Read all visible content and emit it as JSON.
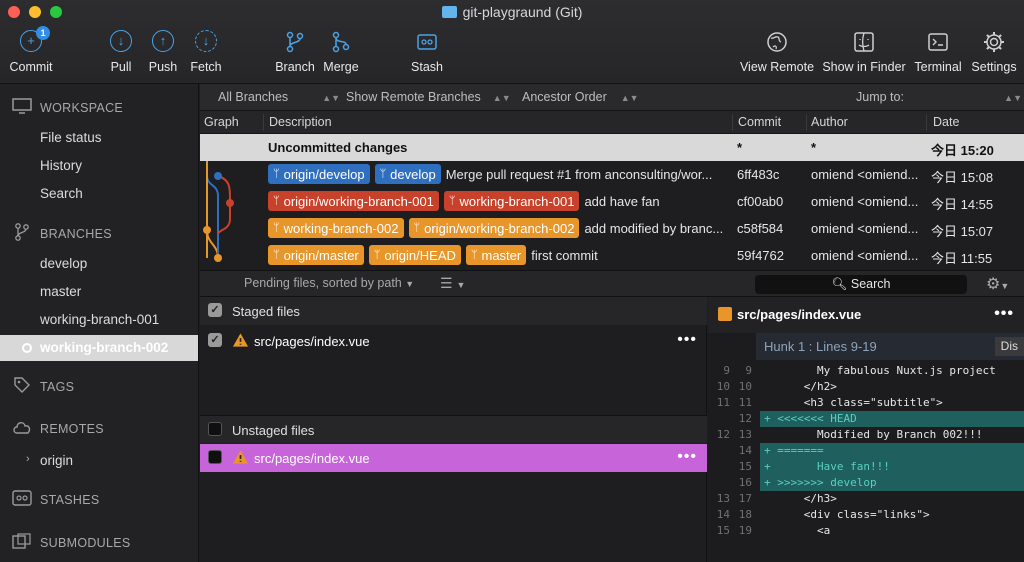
{
  "window": {
    "title": "git-playgraund (Git)"
  },
  "toolbar": {
    "commit": "Commit",
    "commit_badge": "1",
    "pull": "Pull",
    "push": "Push",
    "fetch": "Fetch",
    "branch": "Branch",
    "merge": "Merge",
    "stash": "Stash",
    "view_remote": "View Remote",
    "show_in_finder": "Show in Finder",
    "terminal": "Terminal",
    "settings": "Settings"
  },
  "sidebar": {
    "workspace": "WORKSPACE",
    "workspace_items": [
      "File status",
      "History",
      "Search"
    ],
    "branches": "BRANCHES",
    "branch_items": [
      "develop",
      "master",
      "working-branch-001",
      "working-branch-002"
    ],
    "tags": "TAGS",
    "remotes": "REMOTES",
    "remote_items": [
      "origin"
    ],
    "stashes": "STASHES",
    "submodules": "SUBMODULES"
  },
  "filters": {
    "all_branches": "All Branches",
    "show_remote": "Show Remote Branches",
    "order": "Ancestor Order",
    "jump_to": "Jump to:"
  },
  "columns": {
    "graph": "Graph",
    "description": "Description",
    "commit": "Commit",
    "author": "Author",
    "date": "Date"
  },
  "commits": [
    {
      "message": "Uncommitted changes",
      "commit": "*",
      "author": "*",
      "date": "今日 15:20"
    },
    {
      "tags": [
        "origin/develop",
        "develop"
      ],
      "message": "Merge pull request #1 from anconsulting/wor...",
      "commit": "6ff483c",
      "author": "omiend <omiend...",
      "date": "今日 15:08"
    },
    {
      "tags": [
        "origin/working-branch-001",
        "working-branch-001"
      ],
      "message": "add have fan",
      "commit": "cf00ab0",
      "author": "omiend <omiend...",
      "date": "今日 14:55"
    },
    {
      "tags": [
        "working-branch-002",
        "origin/working-branch-002"
      ],
      "message": "add modified by branc...",
      "commit": "c58f584",
      "author": "omiend <omiend...",
      "date": "今日 15:07"
    },
    {
      "tags": [
        "origin/master",
        "origin/HEAD",
        "master"
      ],
      "message": "first commit",
      "commit": "59f4762",
      "author": "omiend <omiend...",
      "date": "今日 11:55"
    }
  ],
  "pending": {
    "label": "Pending files, sorted by path",
    "search": "Search"
  },
  "staged": {
    "header": "Staged files",
    "files": [
      "src/pages/index.vue"
    ]
  },
  "unstaged": {
    "header": "Unstaged files",
    "files": [
      "src/pages/index.vue"
    ]
  },
  "diff": {
    "file": "src/pages/index.vue",
    "hunk": "Hunk 1 : Lines 9-19",
    "discard": "Dis",
    "lines": [
      {
        "old": "9",
        "new": "9",
        "text": "        My fabulous Nuxt.js project",
        "type": "ctx"
      },
      {
        "old": "10",
        "new": "10",
        "text": "      </h2>",
        "type": "ctx"
      },
      {
        "old": "11",
        "new": "11",
        "text": "      <h3 class=\"subtitle\">",
        "type": "ctx"
      },
      {
        "old": "",
        "new": "12",
        "text": "+ <<<<<<< HEAD",
        "type": "add"
      },
      {
        "old": "12",
        "new": "13",
        "text": "        Modified by Branch 002!!!",
        "type": "ctx"
      },
      {
        "old": "",
        "new": "14",
        "text": "+ =======",
        "type": "add"
      },
      {
        "old": "",
        "new": "15",
        "text": "+       Have fan!!!",
        "type": "add"
      },
      {
        "old": "",
        "new": "16",
        "text": "+ >>>>>>> develop",
        "type": "add"
      },
      {
        "old": "13",
        "new": "17",
        "text": "      </h3>",
        "type": "ctx"
      },
      {
        "old": "14",
        "new": "18",
        "text": "      <div class=\"links\">",
        "type": "ctx"
      },
      {
        "old": "15",
        "new": "19",
        "text": "        <a",
        "type": "ctx"
      }
    ]
  },
  "colors": {
    "blue_tag": "#2f6fc0",
    "red_tag": "#c8422b",
    "orange_tag": "#e8952a",
    "selected_row": "#c764d9",
    "accent": "#4aa3e8"
  }
}
